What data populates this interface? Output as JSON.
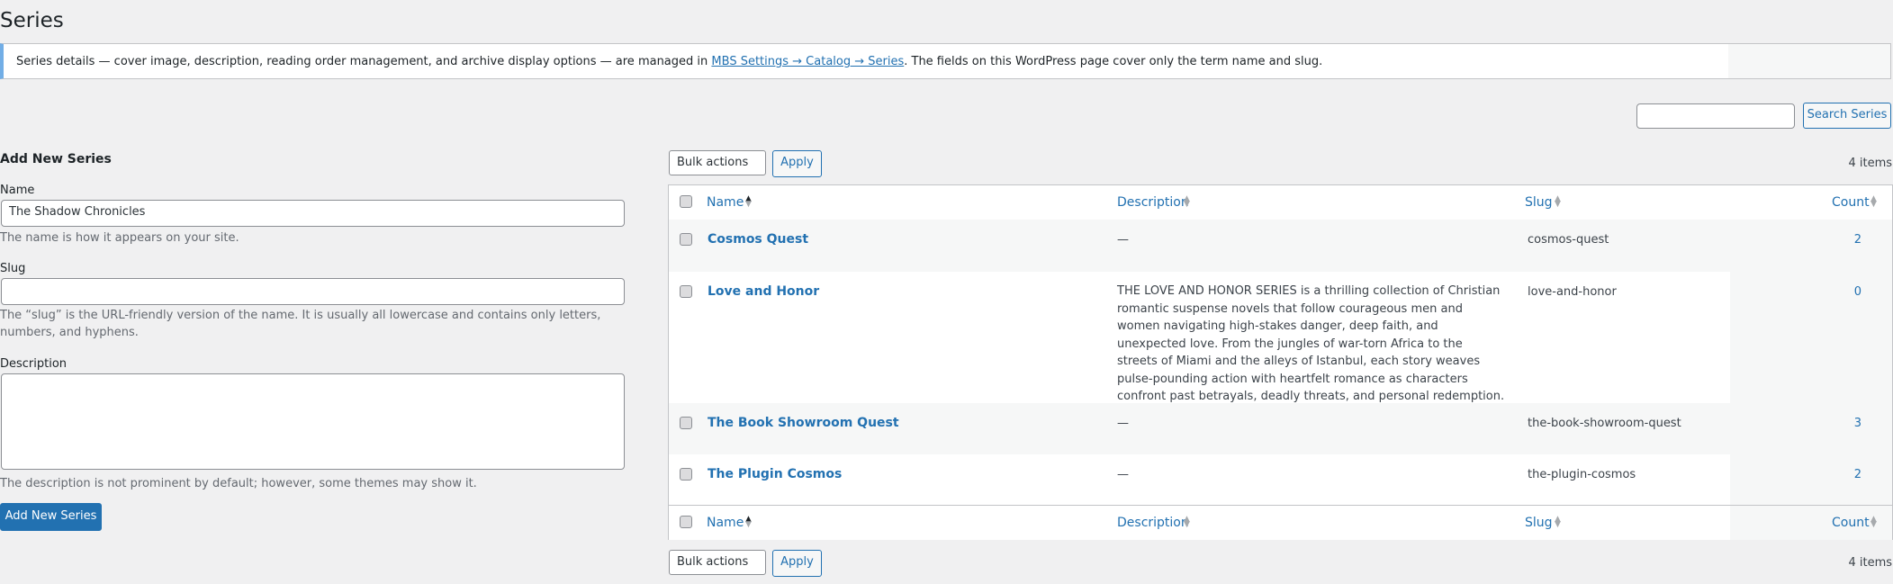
{
  "page": {
    "title": "Series"
  },
  "notice": {
    "before": "Series details — cover image, description, reading order management, and archive display options — are managed in ",
    "link": "MBS Settings → Catalog → Series",
    "after": ". The fields on this WordPress page cover only the term name and slug."
  },
  "search": {
    "value": "",
    "button": "Search Series"
  },
  "form": {
    "heading": "Add New Series",
    "name_label": "Name",
    "name_value": "The Shadow Chronicles",
    "name_help": "The name is how it appears on your site.",
    "slug_label": "Slug",
    "slug_value": "",
    "slug_help": "The “slug” is the URL-friendly version of the name. It is usually all lowercase and contains only letters, numbers, and hyphens.",
    "desc_label": "Description",
    "desc_value": "",
    "desc_help": "The description is not prominent by default; however, some themes may show it.",
    "submit": "Add New Series"
  },
  "bulk": {
    "label": "Bulk actions",
    "apply": "Apply",
    "items": "4 items"
  },
  "table": {
    "columns": {
      "name": "Name",
      "description": "Description",
      "slug": "Slug",
      "count": "Count"
    },
    "rows": [
      {
        "name": "Cosmos Quest",
        "description": "—",
        "slug": "cosmos-quest",
        "count": "2"
      },
      {
        "name": "Love and Honor",
        "description": "THE LOVE AND HONOR SERIES is a thrilling collection of Christian romantic suspense novels that follow courageous men and women navigating high-stakes danger, deep faith, and unexpected love. From the jungles of war-torn Africa to the streets of Miami and the alleys of Istanbul, each story weaves pulse-pounding action with heartfelt romance as characters confront past betrayals, deadly threats, and personal redemption.",
        "slug": "love-and-honor",
        "count": "0"
      },
      {
        "name": "The Book Showroom Quest",
        "description": "—",
        "slug": "the-book-showroom-quest",
        "count": "3"
      },
      {
        "name": "The Plugin Cosmos",
        "description": "—",
        "slug": "the-plugin-cosmos",
        "count": "2"
      }
    ]
  },
  "colors": {
    "accent": "#2271b1",
    "notice_border": "#72aee6",
    "background": "#f0f0f1"
  }
}
